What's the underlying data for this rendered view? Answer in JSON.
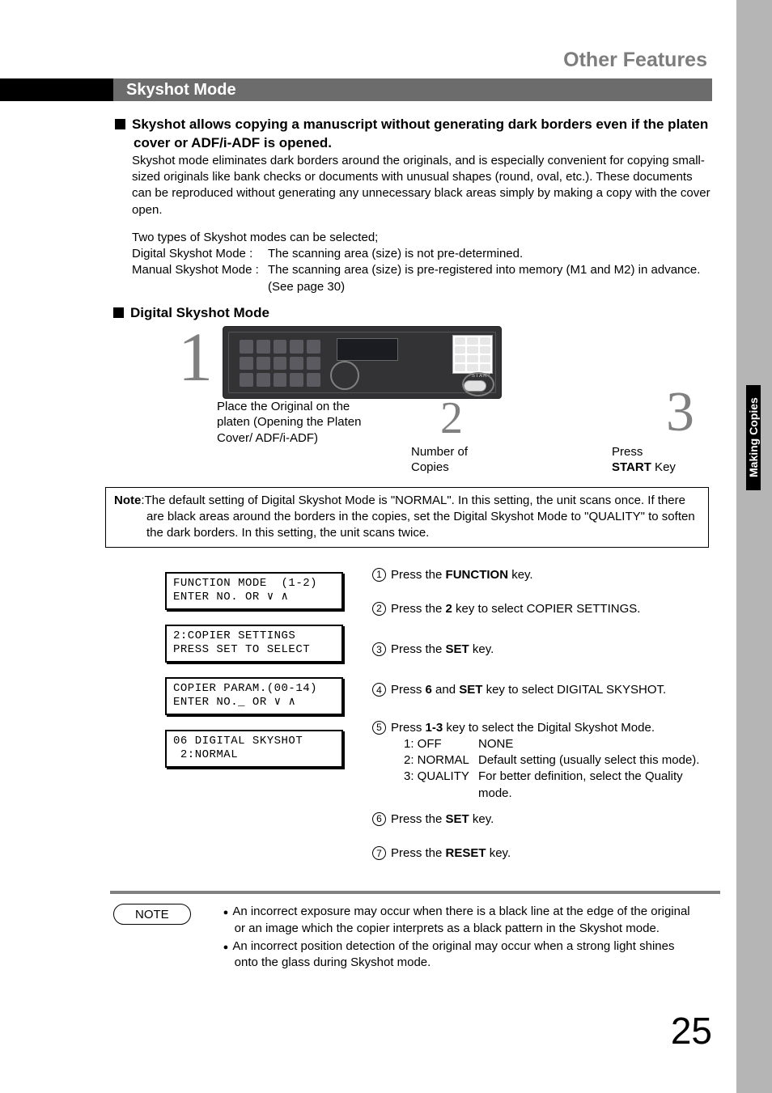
{
  "header": {
    "title": "Other Features"
  },
  "section": {
    "title": "Skyshot Mode"
  },
  "side_tab": "Making Copies",
  "intro": {
    "heading": "Skyshot allows copying a manuscript without generating dark borders even if the platen cover or ADF/i-ADF is opened.",
    "body": "Skyshot mode eliminates dark borders around the originals, and is especially convenient for copying small-sized originals like bank checks or documents with unusual shapes (round, oval, etc.). These documents can be reproduced without generating any unnecessary black areas simply by making a copy with the cover open.",
    "types_intro": "Two types of Skyshot modes can be selected;",
    "digital_label": "Digital Skyshot Mode",
    "digital_sep": " : ",
    "digital_desc": "The scanning area (size) is not pre-determined.",
    "manual_label": "Manual Skyshot Mode",
    "manual_sep": " : ",
    "manual_desc": "The scanning area (size) is pre-registered into memory (M1 and M2) in advance. (See page 30)"
  },
  "sub_heading": "Digital Skyshot Mode",
  "panel_steps": {
    "n1": "1",
    "n2": "2",
    "n3": "3",
    "s1": "Place the Original on the platen (Opening the Platen Cover/ ADF/i-ADF)",
    "s2": "Number of Copies",
    "s3_a": "Press",
    "s3_b": "START",
    "s3_c": " Key"
  },
  "note_box": {
    "label": "Note",
    "text": ":The default setting of Digital Skyshot Mode is \"NORMAL\". In this setting, the unit scans once. If there are black areas around the borders in the copies, set the Digital Skyshot Mode to \"QUALITY\" to soften the dark borders.  In this setting, the unit scans twice."
  },
  "lcd": {
    "l1a": "FUNCTION MODE  (1-2)",
    "l1b": "ENTER NO. OR ∨ ∧",
    "l2a": "2:COPIER SETTINGS",
    "l2b": "PRESS SET TO SELECT",
    "l3a": "COPIER PARAM.(00-14)",
    "l3b": "ENTER NO._ OR ∨ ∧",
    "l4a": "06 DIGITAL SKYSHOT",
    "l4b": " 2:NORMAL"
  },
  "proc": {
    "p1_a": "Press the ",
    "p1_b": "FUNCTION",
    "p1_c": " key.",
    "p2_a": "Press the ",
    "p2_b": "2",
    "p2_c": " key to select COPIER SETTINGS.",
    "p3_a": "Press the ",
    "p3_b": "SET",
    "p3_c": " key.",
    "p4_a": "Press ",
    "p4_b": "6",
    "p4_c": " and ",
    "p4_d": "SET",
    "p4_e": " key to select DIGITAL SKYSHOT.",
    "p5_a": "Press ",
    "p5_b": "1-3",
    "p5_c": " key to select the Digital Skyshot Mode.",
    "p5_1k": "1: OFF",
    "p5_1v": "NONE",
    "p5_2k": "2: NORMAL",
    "p5_2v": "Default setting (usually select this mode).",
    "p5_3k": "3: QUALITY",
    "p5_3v": "For better definition, select the Quality mode.",
    "p6_a": "Press the ",
    "p6_b": "SET",
    "p6_c": " key.",
    "p7_a": "Press the ",
    "p7_b": "RESET",
    "p7_c": " key."
  },
  "footer_note_label": "NOTE",
  "footer_notes": {
    "n1": "An incorrect exposure may occur when there is a black line at the edge of the original or an image which the copier interprets as a black pattern in the Skyshot mode.",
    "n2": "An incorrect position detection of the original may occur when a strong light shines onto the glass during Skyshot mode."
  },
  "page_number": "25"
}
